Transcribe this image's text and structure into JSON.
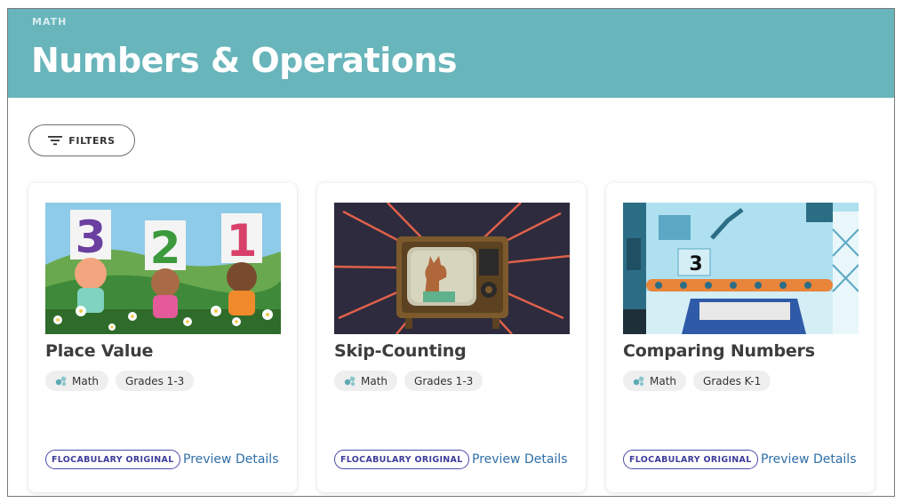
{
  "header": {
    "eyebrow": "MATH",
    "title": "Numbers & Operations",
    "background_color": "#68b5bb"
  },
  "filters": {
    "label": "FILTERS",
    "icon": "filter-lines-icon"
  },
  "cards": [
    {
      "title": "Place Value",
      "tags": [
        {
          "label": "Math",
          "icon": "math-subject-icon"
        },
        {
          "label": "Grades 1-3"
        }
      ],
      "badge": "FLOCABULARY ORIGINAL",
      "link": "Preview Details",
      "thumb_digits": [
        "3",
        "2",
        "1"
      ]
    },
    {
      "title": "Skip-Counting",
      "tags": [
        {
          "label": "Math",
          "icon": "math-subject-icon"
        },
        {
          "label": "Grades 1-3"
        }
      ],
      "badge": "FLOCABULARY ORIGINAL",
      "link": "Preview Details"
    },
    {
      "title": "Comparing Numbers",
      "tags": [
        {
          "label": "Math",
          "icon": "math-subject-icon"
        },
        {
          "label": "Grades K-1"
        }
      ],
      "badge": "FLOCABULARY ORIGINAL",
      "link": "Preview Details",
      "thumb_digits": [
        "3"
      ]
    }
  ],
  "colors": {
    "badge_border": "#4a4aa8",
    "link": "#2f6fa8",
    "tag_bg": "#efefef"
  }
}
